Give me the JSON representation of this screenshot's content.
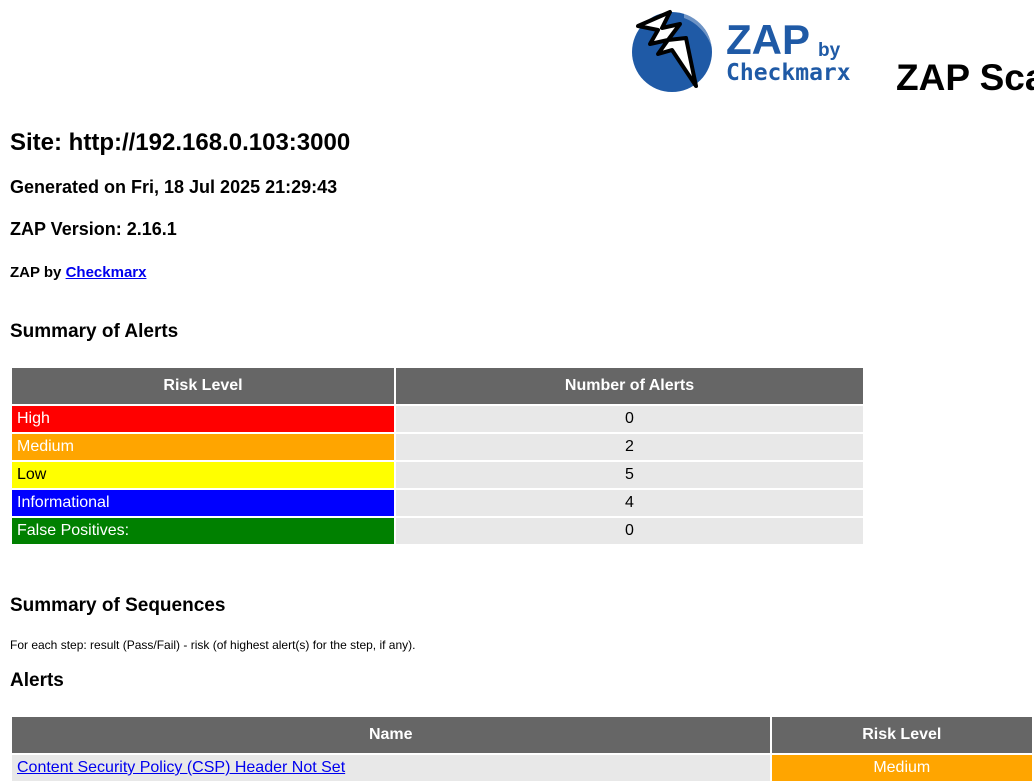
{
  "header": {
    "logo_zap": "ZAP",
    "logo_by": "by",
    "logo_checkmarx": "Checkmarx",
    "title": "ZAP Scanning Report"
  },
  "site": "Site: http://192.168.0.103:3000",
  "generated": "Generated on Fri, 18 Jul 2025 21:29:43",
  "version": "ZAP Version: 2.16.1",
  "byline": {
    "prefix": "ZAP by ",
    "link": "Checkmarx"
  },
  "summary": {
    "heading": "Summary of Alerts",
    "columns": [
      "Risk Level",
      "Number of Alerts"
    ],
    "rows": [
      {
        "level": "High",
        "count": "0",
        "color": "#ff0000"
      },
      {
        "level": "Medium",
        "count": "2",
        "color": "#ffa500"
      },
      {
        "level": "Low",
        "count": "5",
        "color": "#ffff00"
      },
      {
        "level": "Informational",
        "count": "4",
        "color": "#0000ff"
      },
      {
        "level": "False Positives:",
        "count": "0",
        "color": "#008000"
      }
    ]
  },
  "sequences": {
    "heading": "Summary of Sequences",
    "description": "For each step: result (Pass/Fail) - risk (of highest alert(s) for the step, if any)."
  },
  "alerts": {
    "heading": "Alerts",
    "columns": [
      "Name",
      "Risk Level"
    ],
    "rows": [
      {
        "name": "Content Security Policy (CSP) Header Not Set",
        "risk": "Medium",
        "color": "#ffa500"
      }
    ]
  }
}
